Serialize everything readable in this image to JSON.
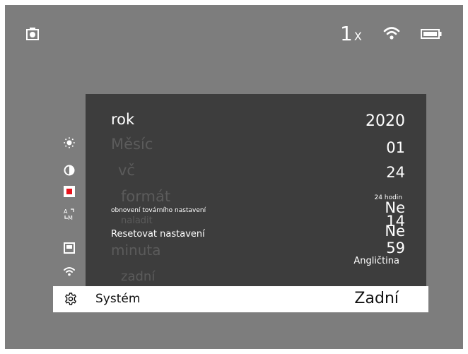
{
  "status": {
    "zoom_value": "1",
    "zoom_unit": "X",
    "icons": [
      "camera-icon",
      "wifi-icon",
      "battery-icon"
    ]
  },
  "menu": {
    "rows": [
      {
        "label": "rok",
        "value": "2020"
      },
      {
        "label": "Měsíc",
        "value": "01"
      },
      {
        "label": "vč",
        "value": "24"
      },
      {
        "label": "formát",
        "value": "24 hodin"
      },
      {
        "label": "obnovení továrního nastavení",
        "value": "Ne"
      },
      {
        "label": "naladit",
        "value": "14"
      },
      {
        "label": "Resetovat nastavení",
        "value": "Ne"
      },
      {
        "label": "minuta",
        "value": "59"
      },
      {
        "label": "",
        "value": "Angličtina"
      },
      {
        "label": "zadní",
        "value": ""
      }
    ]
  },
  "sidebar_icons": [
    "brightness-icon",
    "contrast-icon",
    "record-icon",
    "auto-manual-icon",
    "display-icon",
    "wifi-icon",
    "gear-icon"
  ],
  "selected": {
    "label": "Systém",
    "value": "Zadní"
  },
  "colors": {
    "background": "#7d7d7d",
    "panel": "#3d3d3d",
    "accent_red": "#e8121b",
    "highlight": "#ffffff"
  }
}
